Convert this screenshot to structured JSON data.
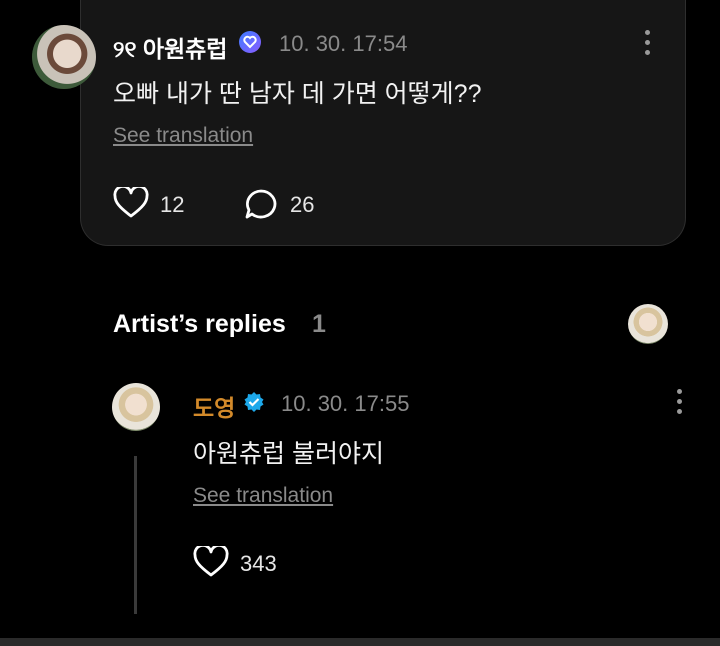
{
  "comment": {
    "username": "୨୧ 아원츄럽",
    "timestamp": "10. 30. 17:54",
    "text": "오빠 내가 딴 남자 데 가면 어떻게??",
    "see_translation": "See translation",
    "likes": "12",
    "replies": "26"
  },
  "artist_replies": {
    "title": "Artist’s replies",
    "count": "1",
    "reply": {
      "username": "도영",
      "timestamp": "10. 30. 17:55",
      "text": "아원츄럽 불러야지",
      "see_translation": "See translation",
      "likes": "343"
    }
  },
  "colors": {
    "background": "#000000",
    "card": "#161616",
    "artist_name": "#d38a2a",
    "verified_badge": "#1da8ea",
    "fan_badge": "#6a6cff"
  }
}
